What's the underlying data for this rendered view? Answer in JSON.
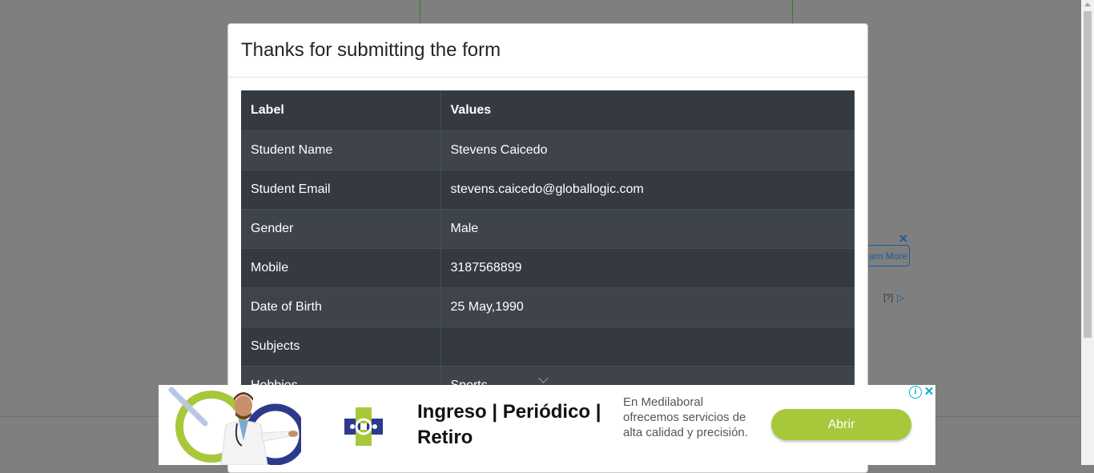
{
  "modal": {
    "title": "Thanks for submitting the form",
    "table": {
      "headers": [
        "Label",
        "Values"
      ],
      "rows": [
        {
          "label": "Student Name",
          "value": "Stevens Caicedo"
        },
        {
          "label": "Student Email",
          "value": "stevens.caicedo@globallogic.com"
        },
        {
          "label": "Gender",
          "value": "Male"
        },
        {
          "label": "Mobile",
          "value": "3187568899"
        },
        {
          "label": "Date of Birth",
          "value": "25 May,1990"
        },
        {
          "label": "Subjects",
          "value": ""
        },
        {
          "label": "Hobbies",
          "value": "Sports"
        }
      ]
    }
  },
  "background_ad": {
    "button_label": "earn More",
    "help_label": "[?]"
  },
  "banner_ad": {
    "headline": "Ingreso | Periódico | Retiro",
    "description": "En Medilaboral ofrecemos servicios de alta calidad y precisión.",
    "cta_label": "Abrir",
    "info_label": "i",
    "close_label": "✕"
  },
  "colors": {
    "overlay": "#7f7f7f",
    "table_dark": "#343a40",
    "table_stripe": "#3e444a",
    "cta_green": "#a6c83a",
    "ad_accent": "#00aecd"
  }
}
